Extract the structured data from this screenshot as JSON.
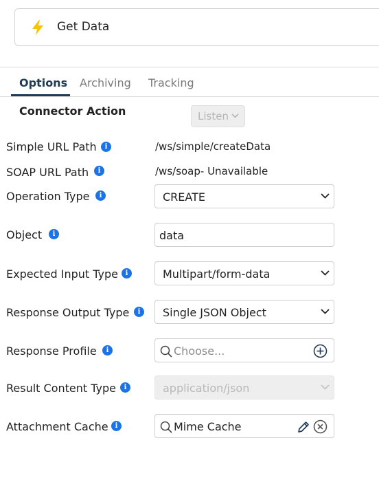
{
  "header": {
    "title": "Get Data",
    "icon": "lightning-bolt-icon",
    "icon_color": "#f6c20a"
  },
  "tabs": [
    {
      "label": "Options",
      "active": true
    },
    {
      "label": "Archiving",
      "active": false
    },
    {
      "label": "Tracking",
      "active": false
    }
  ],
  "connector_action": {
    "label": "Connector Action",
    "value": "Listen"
  },
  "fields": {
    "simple_url_path": {
      "label": "Simple URL Path",
      "value": "/ws/simple/createData"
    },
    "soap_url_path": {
      "label": "SOAP URL Path",
      "value": "/ws/soap- Unavailable"
    },
    "operation_type": {
      "label": "Operation Type",
      "value": "CREATE"
    },
    "object": {
      "label": "Object",
      "value": "data"
    },
    "expected_input_type": {
      "label": "Expected Input Type",
      "value": "Multipart/form-data"
    },
    "response_output_type": {
      "label": "Response Output Type",
      "value": "Single JSON Object"
    },
    "response_profile": {
      "label": "Response Profile",
      "placeholder": "Choose..."
    },
    "result_content_type": {
      "label": "Result Content Type",
      "value": "application/json"
    },
    "attachment_cache": {
      "label": "Attachment Cache",
      "value": "Mime Cache"
    }
  },
  "colors": {
    "accent": "#1f3b57",
    "info": "#1a73e8",
    "bolt": "#f6c20a"
  }
}
